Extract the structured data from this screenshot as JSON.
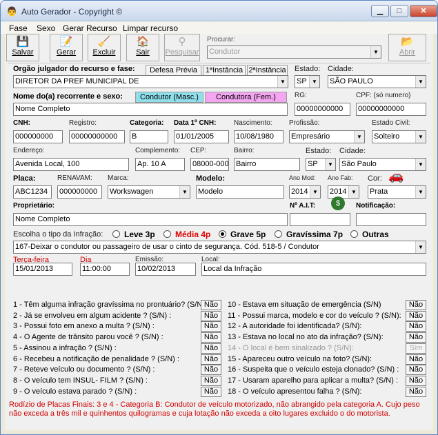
{
  "window": {
    "title": "Auto Gerador - Copyright ©",
    "minimize": "▁",
    "maximize": "□",
    "close": "✕"
  },
  "menu": [
    "Fase",
    "Sexo",
    "Gerar Recurso",
    "Limpar recurso"
  ],
  "toolbar": {
    "salvar": "Salvar",
    "gerar": "Gerar",
    "excluir": "Excluir",
    "sair": "Sair",
    "pesquisar": "Pesquisar",
    "procurar_label": "Procurar:",
    "procurar_value": "Condutor",
    "abrir": "Abrir"
  },
  "orgao": {
    "label": "Orgão julgador do recurso  e  fase:",
    "tabs": [
      "Defesa Prévia",
      "1ªInstância",
      "2ªInstância"
    ],
    "value": "DIRETOR DA PREF MUNICIPAL DE",
    "estado_label": "Estado:",
    "estado": "SP",
    "cidade_label": "Cidade:",
    "cidade": "SÃO PAULO"
  },
  "recorrente": {
    "label": "Nome do(a) recorrente e sexo:",
    "btn_masc": "Condutor (Masc.)",
    "btn_fem": "Condutora (Fem.)",
    "nome": "Nome Completo",
    "rg_label": "RG:",
    "rg": "00000000000",
    "cpf_label": "CPF: (só numero)",
    "cpf": "00000000000"
  },
  "cnh": {
    "cnh_label": "CNH:",
    "cnh": "000000000",
    "registro_label": "Registro:",
    "registro": "00000000000",
    "categoria_label": "Categoria:",
    "categoria": "B",
    "data_label": "Data 1º CNH:",
    "data": "01/01/2005",
    "nasc_label": "Nascimento:",
    "nasc": "10/08/1980",
    "prof_label": "Profissão:",
    "prof": "Empresário",
    "civil_label": "Estado Civil:",
    "civil": "Solteiro"
  },
  "endereco": {
    "end_label": "Endereço:",
    "end": "Avenida Local, 100",
    "comp_label": "Complemento:",
    "comp": "Ap. 10 A",
    "cep_label": "CEP:",
    "cep": "08000-000",
    "bairro_label": "Bairro:",
    "bairro": "Bairro",
    "estado_label": "Estado:",
    "estado": "SP",
    "cidade_label": "Cidade:",
    "cidade": "São Paulo"
  },
  "veiculo": {
    "placa_label": "Placa:",
    "placa": "ABC1234",
    "renavam_label": "RENAVAM:",
    "renavam": "000000000",
    "marca_label": "Marca:",
    "marca": "Workswagen",
    "modelo_label": "Modelo:",
    "modelo": "Modelo",
    "anomod_label": "Ano  Mod:",
    "anomod": "2014",
    "anofab_label": "Ano Fab:",
    "anofab": "2014",
    "cor_label": "Cor:",
    "cor": "Prata"
  },
  "proprietario": {
    "label": "Proprietário:",
    "value": "Nome Completo",
    "ait_label": "Nº A.I.T:",
    "ait": "",
    "notif_label": "Notificação:",
    "notif": ""
  },
  "infracao": {
    "label": "Escolha o tipo da Infração:",
    "options": [
      "Leve 3p",
      "Média 4p",
      "Grave 5p",
      "Gravíssima 7p",
      "Outras"
    ],
    "selected": "Grave 5p",
    "descricao": "167-Deixar o condutor ou passageiro de usar o cinto de segurança. Cód. 518-5 / Condutor",
    "dia_semana": "Terça-feira",
    "data": "15/01/2013",
    "hora_label": "Dia",
    "hora": "11:00:00",
    "emissao_label": "Emissão:",
    "emissao": "10/02/2013",
    "local_label": "Local:",
    "local": "Local da Infração"
  },
  "perguntas_esq": [
    {
      "q": "1 - Têm alguma infração gravíssima no prontuário? (S/N)",
      "a": "Não"
    },
    {
      "q": "2 - Já se envolveu em algum acidente ? (S/N) :",
      "a": "Não"
    },
    {
      "q": "3 - Possui foto em anexo a multa ? (S/N) :",
      "a": "Não"
    },
    {
      "q": "4 - O Agente de trânsito parou você ? (S/N) :",
      "a": "Não"
    },
    {
      "q": "5 - Assinou a infração ? (S/N) :",
      "a": "Não"
    },
    {
      "q": "6 - Recebeu a notificação de penalidade ? (S/N) :",
      "a": "Não"
    },
    {
      "q": "7 - Reteve veículo ou documento ? (S/N) :",
      "a": "Não"
    },
    {
      "q": "8 - O veículo tem INSUL- FILM ? (S/N) :",
      "a": "Não"
    },
    {
      "q": "9 - O veículo estava parado ? (S/N) :",
      "a": "Não"
    }
  ],
  "perguntas_dir": [
    {
      "q": "10 - Estava em situação de emergência  (S/N)",
      "a": "Não"
    },
    {
      "q": "11 - Possui marca, modelo e cor do veículo ? (S/N):",
      "a": "Não"
    },
    {
      "q": "12 - A autoridade foi identificada? (S/N):",
      "a": "Não"
    },
    {
      "q": "13 - Estava no local no ato da infração? (S/N):",
      "a": "Não"
    },
    {
      "q": "14 - O local é bem sinalizado ? (S/N):",
      "a": "Sim"
    },
    {
      "q": "15 - Apareceu outro veículo na foto? (S/N):",
      "a": "Não"
    },
    {
      "q": "16 - Suspeita que o veículo esteja clonado? (S/N) :",
      "a": "Não"
    },
    {
      "q": "17 - Usaram aparelho para aplicar a multa? (S/N) :",
      "a": "Não"
    },
    {
      "q": "18 - O veículo apresentou falha ? (S/N):",
      "a": "Não"
    }
  ],
  "footer": "Rodízio de Placas Finais: 3 e 4 - Categoria B: Condutor de veículo motorizado, não abrangido pela categoria A. Cujo peso não exceda a três mil e quinhentos quilogramas e cuja lotação não exceda a oito lugares excluido o do motorista.",
  "colors": {
    "masc": "#8fe0ec",
    "fem": "#f5a6f2",
    "red_text": "#d00000"
  }
}
